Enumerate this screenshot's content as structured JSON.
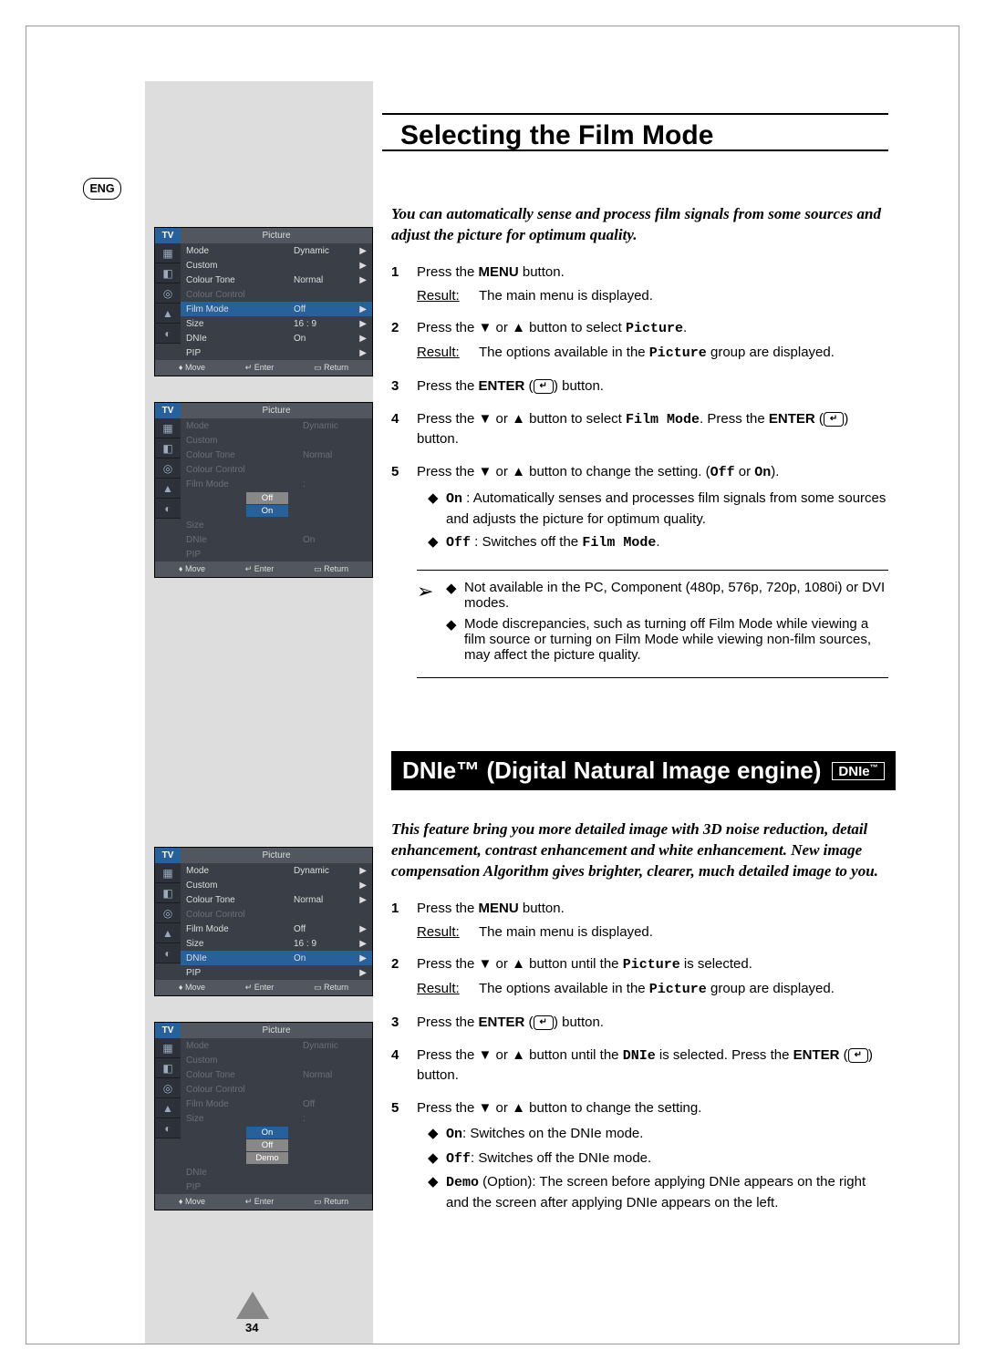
{
  "lang_badge": "ENG",
  "page_number": "34",
  "osd": {
    "tv_label": "TV",
    "menu_title": "Picture",
    "foot_move": "Move",
    "foot_enter": "Enter",
    "foot_return": "Return",
    "items": {
      "mode": {
        "label": "Mode",
        "value": "Dynamic"
      },
      "custom": {
        "label": "Custom"
      },
      "colour_tone": {
        "label": "Colour Tone",
        "value": "Normal"
      },
      "colour_control": {
        "label": "Colour Control"
      },
      "film_mode": {
        "label": "Film Mode",
        "value": "Off"
      },
      "size": {
        "label": "Size",
        "value": "16 : 9"
      },
      "dnie": {
        "label": "DNIe",
        "value": "On"
      },
      "pip": {
        "label": "PIP"
      }
    },
    "popup_off": "Off",
    "popup_on": "On",
    "popup_demo": "Demo"
  },
  "section1": {
    "title": "Selecting the Film Mode",
    "intro": "You can automatically sense and process film signals from some sources and adjust the picture for optimum quality.",
    "steps": {
      "s1": {
        "text": "Press the MENU button.",
        "result_label": "Result:",
        "result_text": "The main menu is displayed."
      },
      "s2": {
        "pre": "Press the ",
        "mid": " or ",
        "post": " button to select ",
        "target": "Picture",
        "end": ".",
        "result_label": "Result:",
        "result_text_a": "The options available in the ",
        "result_target": "Picture",
        "result_text_b": " group are displayed."
      },
      "s3": {
        "pre": "Press the ",
        "b": "ENTER",
        "post": " (",
        "icon": "↵",
        "end": ") button."
      },
      "s4": {
        "pre": "Press the ",
        "mid": " or ",
        "post": " button to select ",
        "target": "Film Mode",
        "after": ". Press the ",
        "b": "ENTER",
        "p2": " (",
        "icon": "↵",
        "end": ") button."
      },
      "s5": {
        "pre": "Press the ",
        "mid": " or ",
        "post": " button to change the setting. (",
        "opt_off": "Off",
        "join": " or ",
        "opt_on": "On",
        "end": ").",
        "on_label": "On",
        "on_sep": " : ",
        "on_text": "Automatically senses and processes film signals from some sources and adjusts the picture for optimum quality.",
        "off_label": "Off",
        "off_sep": " : ",
        "off_text_a": "Switches off the ",
        "off_target": "Film Mode",
        "off_text_b": "."
      }
    },
    "note": {
      "n1": "Not available in the PC, Component (480p, 576p, 720p, 1080i) or DVI modes.",
      "n2": "Mode discrepancies, such as turning off Film Mode while viewing a film source or turning on Film Mode while viewing non-film sources, may affect the picture quality."
    }
  },
  "section2": {
    "title": "DNIe™ (Digital Natural Image engine)",
    "logo": "DNIe",
    "logo_sup": "™",
    "intro": "This feature bring you more detailed image with 3D noise reduction, detail enhancement, contrast enhancement and white enhancement. New image compensation Algorithm gives brighter, clearer, much detailed image to you.",
    "steps": {
      "s1": {
        "text": "Press the MENU button.",
        "result_label": "Result:",
        "result_text": "The main menu is displayed."
      },
      "s2": {
        "pre": "Press the ",
        "mid": " or ",
        "post": " button until the ",
        "target": "Picture",
        "end": " is selected.",
        "result_label": "Result:",
        "result_text_a": "The options available in the ",
        "result_target": "Picture",
        "result_text_b": " group are displayed."
      },
      "s3": {
        "pre": "Press the ",
        "b": "ENTER",
        "post": " (",
        "end": ") button."
      },
      "s4": {
        "pre": "Press the ",
        "mid": " or ",
        "post": " button until the ",
        "target": "DNIe",
        "after": " is selected. Press the ",
        "b": "ENTER",
        "p2": " (",
        "end": ") button."
      },
      "s5": {
        "pre": "Press the ",
        "mid": " or ",
        "post": " button to change the setting.",
        "on_label": "On",
        "on_text": ": Switches on the DNIe mode.",
        "off_label": "Off",
        "off_text": ": Switches off the DNIe mode.",
        "demo_label": "Demo",
        "demo_text": " (Option): The screen before applying DNIe appears on the  right and the screen after applying DNIe appears on the left."
      }
    }
  }
}
